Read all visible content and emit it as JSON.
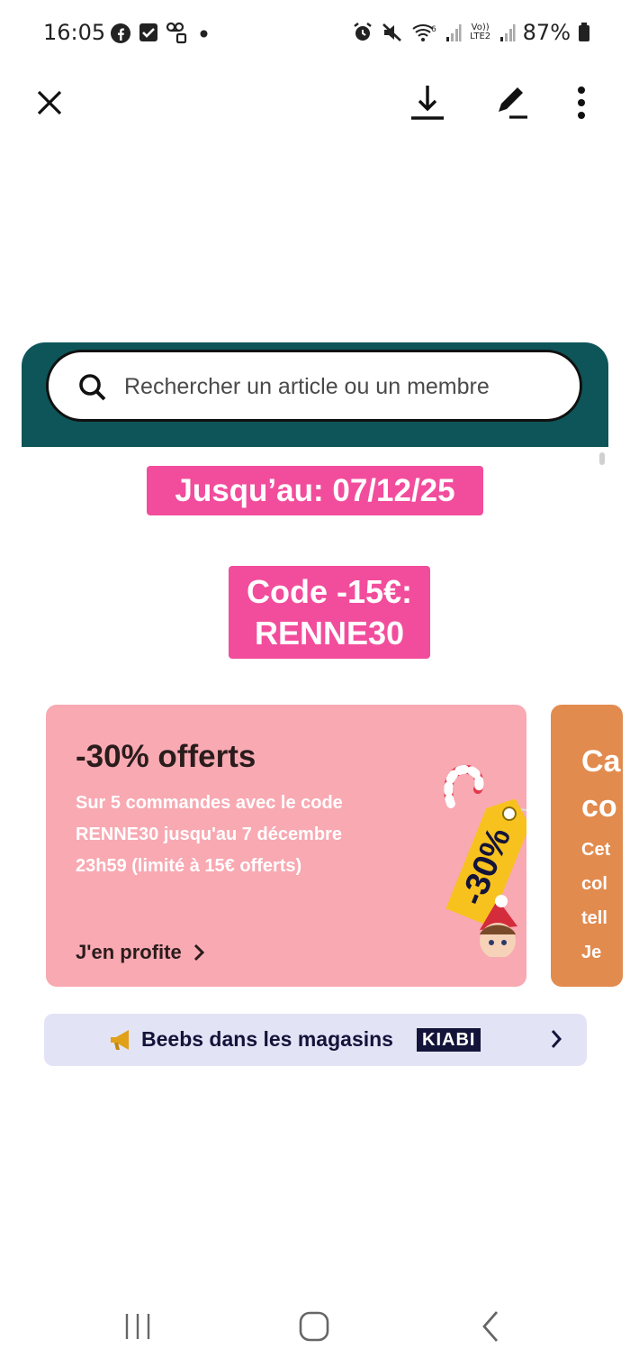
{
  "status_bar": {
    "time": "16:05",
    "battery": "87%",
    "left_icons": [
      "facebook-icon",
      "check-box-icon",
      "voicemail-icon",
      "dot-icon"
    ],
    "right_icons": [
      "alarm-icon",
      "mute-icon",
      "wifi-icon",
      "signal-icon",
      "volte-icon",
      "signal-icon",
      "battery-icon"
    ],
    "volte_label": "Vo)) LTE2"
  },
  "toolbar": {
    "icons": [
      "close-icon",
      "download-icon",
      "edit-icon",
      "more-vert-icon"
    ]
  },
  "screenshot": {
    "header_color": "#0e5559",
    "search_placeholder": "Rechercher un article ou un membre",
    "date_pill": "Jusqu’au: 07/12/25",
    "code_line1": "Code -15€:",
    "code_line2": "RENNE30",
    "accent_pink": "#f24d9c",
    "promo_card": {
      "title": "-30% offerts",
      "description": "Sur 5 commandes avec le code RENNE30 jusqu'au 7 décembre 23h59 (limité à 15€ offerts)",
      "cta": "J'en profite",
      "tag_text": "-30%",
      "background": "#f8a9b2"
    },
    "second_card": {
      "title": "Ca\nco",
      "body": "Cet\ncol\ntell",
      "cta": "Je",
      "background": "#e28b4e"
    },
    "store_banner": {
      "text": "Beebs dans les magasins",
      "brand": "KIABI",
      "background": "#e3e3f6"
    }
  },
  "nav_bar": {
    "icons": [
      "recent-apps-icon",
      "home-icon",
      "back-icon"
    ]
  }
}
